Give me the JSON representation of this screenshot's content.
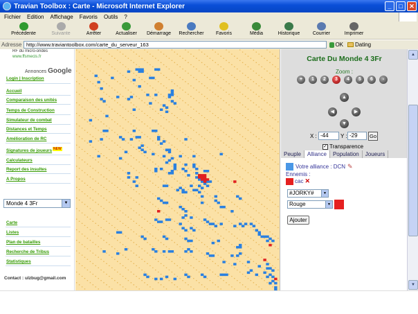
{
  "window": {
    "title": "Travian Toolbox : Carte - Microsoft Internet Explorer",
    "buttons": [
      "_",
      "□",
      "✕"
    ]
  },
  "menubar": [
    "Fichier",
    "Edition",
    "Affichage",
    "Favoris",
    "Outils",
    "?"
  ],
  "toolbar": [
    {
      "label": "Précédente",
      "icon": "back-icon",
      "color": "#2f9a2f",
      "enabled": true
    },
    {
      "label": "Suivante",
      "icon": "forward-icon",
      "color": "#aaaaaa",
      "enabled": false
    },
    {
      "label": "Arrêter",
      "icon": "stop-icon",
      "color": "#d04020",
      "enabled": true
    },
    {
      "label": "Actualiser",
      "icon": "refresh-icon",
      "color": "#3a9a3a",
      "enabled": true
    },
    {
      "label": "Démarrage",
      "icon": "home-icon",
      "color": "#d08030",
      "enabled": true
    },
    {
      "label": "Rechercher",
      "icon": "search-icon",
      "color": "#4a7ac0",
      "enabled": true
    },
    {
      "label": "Favoris",
      "icon": "favorites-icon",
      "color": "#e0c020",
      "enabled": true
    },
    {
      "label": "Média",
      "icon": "media-icon",
      "color": "#3a8a3a",
      "enabled": true
    },
    {
      "label": "Historique",
      "icon": "history-icon",
      "color": "#3a7a4a",
      "enabled": true
    },
    {
      "label": "Courrier",
      "icon": "mail-icon",
      "color": "#5a7ab0",
      "enabled": true
    },
    {
      "label": "Imprimer",
      "icon": "print-icon",
      "color": "#666666",
      "enabled": true
    }
  ],
  "address": {
    "label": "Adresse",
    "url": "http://www.traviantoolbox.com/carte_du_serveur_163",
    "go": "OK",
    "bookmark": "Dating"
  },
  "sidebar": {
    "ad_line1": "RF du micro-ondes",
    "ad_line2": "www.ffsmecis.fr",
    "ads_by": "Annonces",
    "ads_brand": "Google",
    "login": "Login | Inscription",
    "links": [
      "Accueil",
      "Comparaison des unités",
      "Temps de Construction",
      "Simulateur de combat",
      "Distances et Temps",
      "Amélioration de RC",
      "Signatures de joueurs",
      "Calculateurs",
      "Report des insultes",
      "A Propos"
    ],
    "new_badge": "NEW",
    "world": "Monde 4 3Fr",
    "links2": [
      "Carte",
      "Listes",
      "Plan de batailles",
      "Recherche de Tribus",
      "Statistiques"
    ],
    "contact": "Contact : ulzbug@gmail.com"
  },
  "panel": {
    "title": "Carte Du Monde 4 3Fr",
    "zoom_label": "Zoom :",
    "zoom_levels": [
      "+",
      "1",
      "2",
      "3",
      "4",
      "5",
      "6",
      "-"
    ],
    "zoom_active": 3,
    "x_label": "X :",
    "x_value": "-44",
    "y_label": "Y :",
    "y_value": "-29",
    "go": "Go",
    "transparency": "Transparence",
    "transparency_checked": true,
    "tabs": [
      "Peuple",
      "Alliance",
      "Population",
      "Joueurs"
    ],
    "active_tab": 1,
    "ally_text": "Votre alliance : DCN",
    "enemies_label": "Ennemis :",
    "enemy_name": "cac",
    "select_alliance": "#JORKY#",
    "select_color": "Rouge",
    "add": "Ajouter",
    "colors": {
      "ally": "#4a97e6",
      "enemy": "#e52020"
    }
  },
  "map": {
    "ally_color": "#2a80e0",
    "enemy_color": "#e02020",
    "ally_cells": [
      [
        22,
        9
      ],
      [
        23,
        9
      ],
      [
        24,
        9
      ],
      [
        23,
        10
      ],
      [
        24,
        10
      ],
      [
        29,
        9
      ],
      [
        30,
        9
      ],
      [
        19,
        10
      ],
      [
        28,
        13
      ],
      [
        13,
        13
      ],
      [
        27,
        13
      ],
      [
        21,
        14
      ],
      [
        8,
        15
      ],
      [
        7,
        12
      ],
      [
        23,
        17
      ],
      [
        9,
        18
      ],
      [
        26,
        21
      ],
      [
        29,
        21
      ],
      [
        20,
        22
      ],
      [
        35,
        19
      ],
      [
        35,
        20
      ],
      [
        35,
        21
      ],
      [
        34,
        21
      ],
      [
        34,
        22
      ],
      [
        15,
        22
      ],
      [
        9,
        23
      ],
      [
        19,
        23
      ],
      [
        10,
        24
      ],
      [
        35,
        24
      ],
      [
        36,
        25
      ],
      [
        27,
        25
      ],
      [
        21,
        28
      ],
      [
        32,
        26
      ],
      [
        33,
        27
      ],
      [
        33,
        29
      ],
      [
        31,
        28
      ],
      [
        5,
        33
      ],
      [
        11,
        31
      ],
      [
        21,
        38
      ],
      [
        28,
        38
      ],
      [
        29,
        38
      ],
      [
        11,
        38
      ],
      [
        10,
        38
      ],
      [
        16,
        41
      ],
      [
        22,
        41
      ],
      [
        23,
        41
      ],
      [
        30,
        41
      ],
      [
        40,
        42
      ],
      [
        30,
        42
      ],
      [
        20,
        42
      ],
      [
        17,
        42
      ],
      [
        5,
        43
      ],
      [
        9,
        42
      ],
      [
        32,
        43
      ],
      [
        31,
        44
      ],
      [
        24,
        45
      ],
      [
        23,
        46
      ],
      [
        24,
        47
      ],
      [
        33,
        47
      ],
      [
        34,
        47
      ],
      [
        18,
        48
      ],
      [
        34,
        48
      ],
      [
        25,
        48
      ],
      [
        28,
        49
      ],
      [
        8,
        50
      ],
      [
        32,
        50
      ],
      [
        16,
        51
      ],
      [
        38,
        50
      ],
      [
        35,
        51
      ],
      [
        34,
        52
      ],
      [
        33,
        53
      ],
      [
        36,
        54
      ],
      [
        36,
        55
      ],
      [
        40,
        54
      ],
      [
        36,
        56
      ],
      [
        31,
        56
      ],
      [
        35,
        57
      ],
      [
        34,
        58
      ],
      [
        35,
        58
      ],
      [
        40,
        57
      ],
      [
        39,
        56
      ],
      [
        43,
        54
      ],
      [
        43,
        55
      ],
      [
        44,
        56
      ],
      [
        44,
        58
      ],
      [
        45,
        59
      ],
      [
        41,
        59
      ],
      [
        44,
        60
      ],
      [
        45,
        61
      ],
      [
        42,
        64
      ],
      [
        46,
        62
      ],
      [
        45,
        64
      ],
      [
        47,
        63
      ],
      [
        46,
        65
      ],
      [
        43,
        66
      ],
      [
        44,
        66
      ],
      [
        45,
        67
      ],
      [
        46,
        69
      ],
      [
        46,
        72
      ],
      [
        51,
        69
      ],
      [
        51,
        71
      ],
      [
        52,
        72
      ],
      [
        53,
        74
      ],
      [
        54,
        74
      ],
      [
        57,
        76
      ],
      [
        59,
        69
      ],
      [
        60,
        70
      ],
      [
        48,
        62
      ],
      [
        48,
        64
      ],
      [
        48,
        57
      ],
      [
        47,
        57
      ],
      [
        49,
        62
      ],
      [
        53,
        49
      ],
      [
        29,
        56
      ],
      [
        29,
        57
      ],
      [
        43,
        50
      ],
      [
        19,
        58
      ],
      [
        19,
        60
      ],
      [
        22,
        60
      ],
      [
        21,
        62
      ],
      [
        22,
        64
      ],
      [
        32,
        64
      ],
      [
        33,
        64
      ],
      [
        37,
        66
      ],
      [
        38,
        65
      ],
      [
        39,
        66
      ],
      [
        39,
        67
      ],
      [
        40,
        67
      ],
      [
        30,
        70
      ],
      [
        31,
        71
      ],
      [
        32,
        72
      ],
      [
        33,
        72
      ],
      [
        38,
        74
      ],
      [
        39,
        75
      ],
      [
        40,
        76
      ],
      [
        40,
        78
      ],
      [
        39,
        79
      ],
      [
        42,
        79
      ],
      [
        47,
        80
      ],
      [
        48,
        81
      ],
      [
        49,
        82
      ],
      [
        50,
        82
      ],
      [
        51,
        83
      ],
      [
        53,
        82
      ],
      [
        58,
        83
      ],
      [
        60,
        82
      ],
      [
        61,
        83
      ],
      [
        62,
        82
      ],
      [
        64,
        82
      ],
      [
        65,
        83
      ],
      [
        66,
        85
      ],
      [
        67,
        86
      ],
      [
        67,
        87
      ],
      [
        68,
        88
      ],
      [
        69,
        88
      ],
      [
        70,
        88
      ],
      [
        70,
        90
      ],
      [
        72,
        90
      ],
      [
        71,
        89
      ],
      [
        60,
        92
      ],
      [
        59,
        93
      ],
      [
        60,
        93
      ],
      [
        50,
        91
      ],
      [
        52,
        90
      ],
      [
        29,
        80
      ],
      [
        30,
        81
      ],
      [
        31,
        81
      ],
      [
        33,
        80
      ],
      [
        34,
        80
      ],
      [
        38,
        82
      ],
      [
        39,
        84
      ],
      [
        40,
        85
      ],
      [
        42,
        84
      ],
      [
        43,
        85
      ],
      [
        40,
        89
      ],
      [
        41,
        90
      ],
      [
        42,
        90
      ],
      [
        24,
        88
      ],
      [
        25,
        89
      ],
      [
        32,
        88
      ],
      [
        33,
        89
      ],
      [
        15,
        86
      ],
      [
        16,
        86
      ],
      [
        15,
        96
      ],
      [
        10,
        95
      ],
      [
        18,
        94
      ],
      [
        28,
        94
      ],
      [
        29,
        95
      ],
      [
        32,
        95
      ],
      [
        34,
        95
      ],
      [
        35,
        95
      ],
      [
        40,
        95
      ],
      [
        41,
        94
      ],
      [
        42,
        95
      ],
      [
        48,
        96
      ],
      [
        49,
        97
      ],
      [
        50,
        97
      ],
      [
        57,
        97
      ],
      [
        59,
        97
      ],
      [
        60,
        96
      ],
      [
        54,
        100
      ],
      [
        58,
        101
      ],
      [
        67,
        102
      ],
      [
        63,
        105
      ],
      [
        66,
        106
      ],
      [
        53,
        106
      ],
      [
        54,
        106
      ],
      [
        55,
        106
      ],
      [
        46,
        106
      ],
      [
        47,
        107
      ],
      [
        25,
        106
      ],
      [
        26,
        107
      ],
      [
        29,
        108
      ],
      [
        31,
        108
      ],
      [
        33,
        107
      ],
      [
        36,
        108
      ],
      [
        40,
        106
      ],
      [
        41,
        107
      ],
      [
        64,
        104
      ],
      [
        63,
        100
      ],
      [
        70,
        101
      ],
      [
        70,
        103
      ],
      [
        71,
        103
      ],
      [
        72,
        104
      ],
      [
        69,
        105
      ],
      [
        71,
        106
      ],
      [
        70,
        107
      ],
      [
        72,
        107
      ],
      [
        72,
        109
      ],
      [
        71,
        110
      ],
      [
        73,
        110
      ],
      [
        73,
        112
      ],
      [
        73,
        113
      ],
      [
        74,
        114
      ]
    ],
    "enemy_cells": [
      [
        45,
        59
      ],
      [
        46,
        59
      ],
      [
        47,
        59
      ],
      [
        45,
        60
      ],
      [
        46,
        60
      ],
      [
        47,
        60
      ],
      [
        46,
        61
      ],
      [
        47,
        61
      ],
      [
        48,
        61
      ],
      [
        47,
        62
      ],
      [
        30,
        76
      ],
      [
        71,
        92
      ],
      [
        69,
        99
      ],
      [
        73,
        108
      ],
      [
        58,
        62
      ]
    ]
  }
}
